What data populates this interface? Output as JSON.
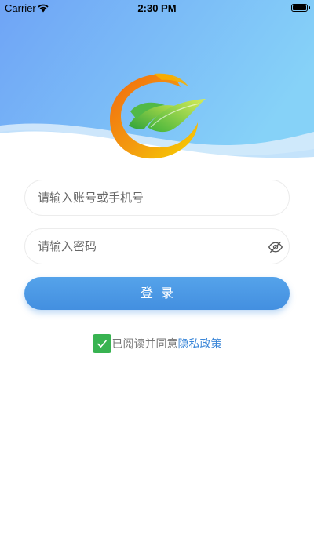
{
  "status_bar": {
    "carrier": "Carrier",
    "time": "2:30 PM",
    "battery_level": 1.0
  },
  "login_form": {
    "account_placeholder": "请输入账号或手机号",
    "password_placeholder": "请输入密码",
    "login_label": "登录",
    "agree_text": "已阅读并同意",
    "policy_link": "隐私政策",
    "agree_checked": true
  },
  "icons": {
    "wifi": "wifi-icon",
    "battery": "battery-icon",
    "logo": "app-logo",
    "password_visibility": "eye-off-icon",
    "checkbox": "checkmark-icon"
  },
  "colors": {
    "header_gradient_start": "#6fa7f7",
    "header_gradient_end": "#82cdf7",
    "login_button": "#4a96e5",
    "checkbox": "#38b351",
    "link": "#3a86d8",
    "logo_orange": "#f07818",
    "logo_yellow": "#f5c500",
    "logo_green": "#5cc23a"
  }
}
